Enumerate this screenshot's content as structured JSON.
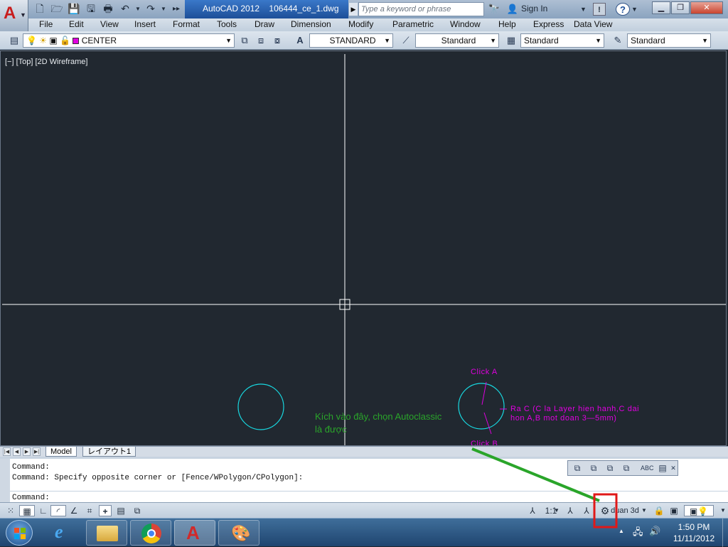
{
  "window": {
    "app_title": "AutoCAD 2012",
    "file_name": "106444_ce_1.dwg",
    "search_placeholder": "Type a keyword or phrase",
    "sign_in": "Sign In"
  },
  "menu": [
    "File",
    "Edit",
    "View",
    "Insert",
    "Format",
    "Tools",
    "Draw",
    "Dimension",
    "Modify",
    "Parametric",
    "Window",
    "Help",
    "Express",
    "Data View"
  ],
  "toolbar": {
    "layer_name": "CENTER",
    "layer_color": "#e000e0",
    "text_style": "STANDARD",
    "dim_style": "Standard",
    "table_style": "Standard",
    "multileader_style": "Standard"
  },
  "viewport": {
    "label": "[−] [Top] [2D Wireframe]"
  },
  "annotations": {
    "click_a": "Click A",
    "click_b": "Click B",
    "note_line1": "Ra C (C la Layer hien hanh,C dai",
    "note_line2": "hon A,B mot doan 3—5mm)",
    "callout_line1": "Kích vào đây, chọn Autoclassic",
    "callout_line2": "là được"
  },
  "colors": {
    "circle": "#18d8e0",
    "magenta": "#e000e0",
    "callout_green": "#2aa52a",
    "highlight_box": "#e01818",
    "crosshair": "#ffffff"
  },
  "layout_tabs": {
    "model": "Model",
    "layout1": "レイアウト1"
  },
  "command": {
    "line1": "Command:",
    "line2": "Command: Specify opposite corner or [Fence/WPolygon/CPolygon]:",
    "prompt": "Command:"
  },
  "status": {
    "scale": "1:1",
    "workspace": "duan 3d"
  },
  "clock": {
    "time": "1:50 PM",
    "date": "11/11/2012"
  }
}
